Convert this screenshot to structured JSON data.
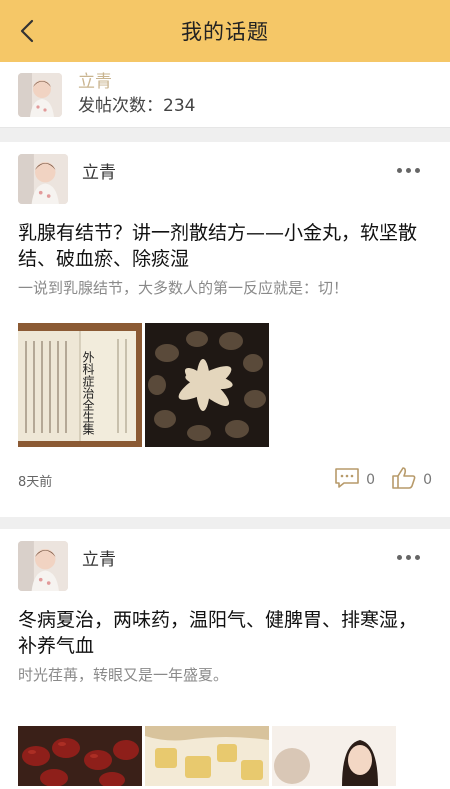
{
  "header": {
    "title": "我的话题"
  },
  "profile": {
    "name": "立青",
    "post_count_label": "发帖次数：234"
  },
  "posts": [
    {
      "author": "立青",
      "title": "乳腺有结节？讲一剂散结方——小金丸，软坚散结、破血瘀、除痰湿",
      "excerpt": "一说到乳腺结节，大多数人的第一反应就是：切！",
      "book_text": "外科症治全生集",
      "time": "8天前",
      "comments": "0",
      "likes": "0"
    },
    {
      "author": "立青",
      "title": "冬病夏治，两味药，温阳气、健脾胃、排寒湿，补养气血",
      "excerpt": "时光荏苒，转眼又是一年盛夏。"
    }
  ],
  "colors": {
    "header": "#f5c767",
    "profile_name": "#c9b48f",
    "background": "#efefef"
  }
}
